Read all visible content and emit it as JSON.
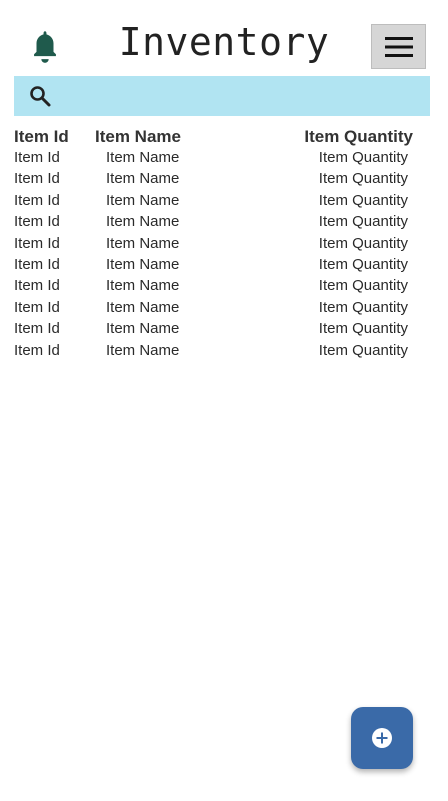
{
  "header": {
    "title": "Inventory",
    "bell_icon": "notification-bell-icon",
    "menu_icon": "hamburger-menu-icon"
  },
  "search": {
    "icon": "search-icon",
    "value": "",
    "placeholder": ""
  },
  "table": {
    "columns": [
      "Item Id",
      "Item Name",
      "Item Quantity"
    ],
    "rows": [
      [
        "Item Id",
        "Item Name",
        "Item Quantity"
      ],
      [
        "Item Id",
        "Item Name",
        "Item Quantity"
      ],
      [
        "Item Id",
        "Item Name",
        "Item Quantity"
      ],
      [
        "Item Id",
        "Item Name",
        "Item Quantity"
      ],
      [
        "Item Id",
        "Item Name",
        "Item Quantity"
      ],
      [
        "Item Id",
        "Item Name",
        "Item Quantity"
      ],
      [
        "Item Id",
        "Item Name",
        "Item Quantity"
      ],
      [
        "Item Id",
        "Item Name",
        "Item Quantity"
      ],
      [
        "Item Id",
        "Item Name",
        "Item Quantity"
      ],
      [
        "Item Id",
        "Item Name",
        "Item Quantity"
      ]
    ]
  },
  "fab": {
    "icon": "add-circle-icon"
  },
  "colors": {
    "bell": "#1f5a4c",
    "search_bg": "#b1e4f2",
    "menu_bg": "#d6d6d6",
    "fab_bg": "#3a6aa8"
  }
}
